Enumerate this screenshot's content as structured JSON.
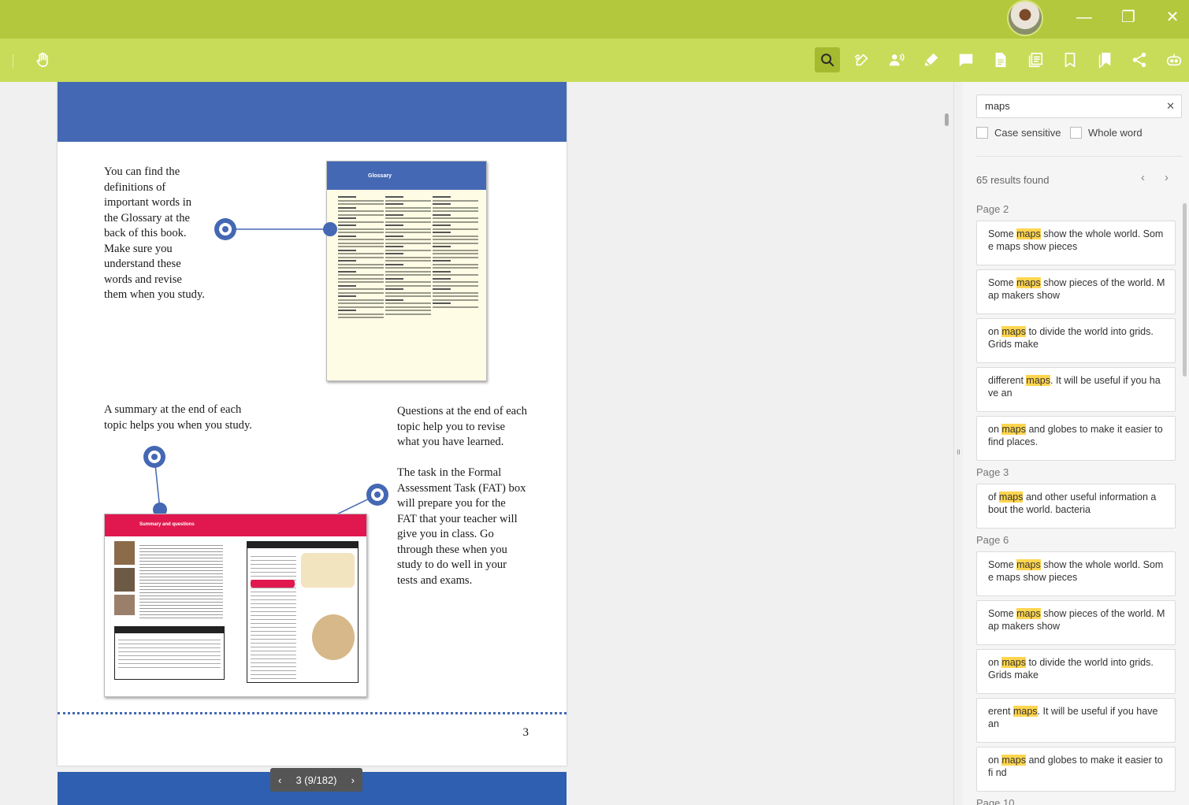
{
  "window": {
    "minimize_glyph": "—",
    "maximize_glyph": "❐",
    "close_glyph": "✕"
  },
  "toolbar": {
    "icons": [
      "hand-icon",
      "search-icon",
      "draw-icon",
      "read-aloud-icon",
      "highlighter-icon",
      "comment-icon",
      "page-icon",
      "pages-icon",
      "bookmark-icon",
      "bookmarks-icon",
      "share-icon",
      "robot-icon"
    ]
  },
  "document": {
    "text_glossary": "You can find the definitions of important words in the Glossary at the back of this book. Make sure you understand these words and revise them when you study.",
    "text_summary": "A summary at the end of each topic helps you when you study.",
    "text_questions": "Questions at the end of each topic help you to revise what you have learned.",
    "text_fat": "The task in the Formal Assessment Task (FAT) box will prepare you for the FAT that your teacher will give you in class. Go through these when you study to do well in your tests and exams.",
    "glossary_thumb_title": "Glossary",
    "summary_thumb_title": "Summary and questions",
    "page_number": "3",
    "pager_label": "3 (9/182)",
    "accent_color": "#4468b3"
  },
  "search": {
    "query": "maps",
    "case_sensitive_label": "Case sensitive",
    "whole_word_label": "Whole word",
    "results_found": "65 results found",
    "groups": [
      {
        "page": "Page 2",
        "results": [
          {
            "before": "Some ",
            "match": "maps",
            "after": " show the whole world. Som e maps show pieces"
          },
          {
            "before": "Some ",
            "match": "maps",
            "after": " show pieces of the world. M ap makers show"
          },
          {
            "before": "on ",
            "match": "maps",
            "after": " to divide the world into grids. Grids make"
          },
          {
            "before": "different ",
            "match": "maps",
            "after": ". It will be useful if you ha ve an"
          },
          {
            "before": "on ",
            "match": "maps",
            "after": " and globes to make it easier to find places."
          }
        ]
      },
      {
        "page": "Page 3",
        "results": [
          {
            "before": "of ",
            "match": "maps",
            "after": " and other useful information a bout the world. bacteria"
          }
        ]
      },
      {
        "page": "Page 6",
        "results": [
          {
            "before": "Some ",
            "match": "maps",
            "after": " show the whole world. Som e maps show pieces"
          },
          {
            "before": "Some ",
            "match": "maps",
            "after": " show pieces of the world. M ap makers show"
          },
          {
            "before": "on ",
            "match": "maps",
            "after": " to divide the world into grids. Grids make"
          },
          {
            "before": "erent ",
            "match": "maps",
            "after": ". It will be useful if you have an"
          },
          {
            "before": "on ",
            "match": "maps",
            "after": " and globes to make it easier to fi nd"
          }
        ]
      },
      {
        "page": "Page 10",
        "results": []
      }
    ]
  }
}
